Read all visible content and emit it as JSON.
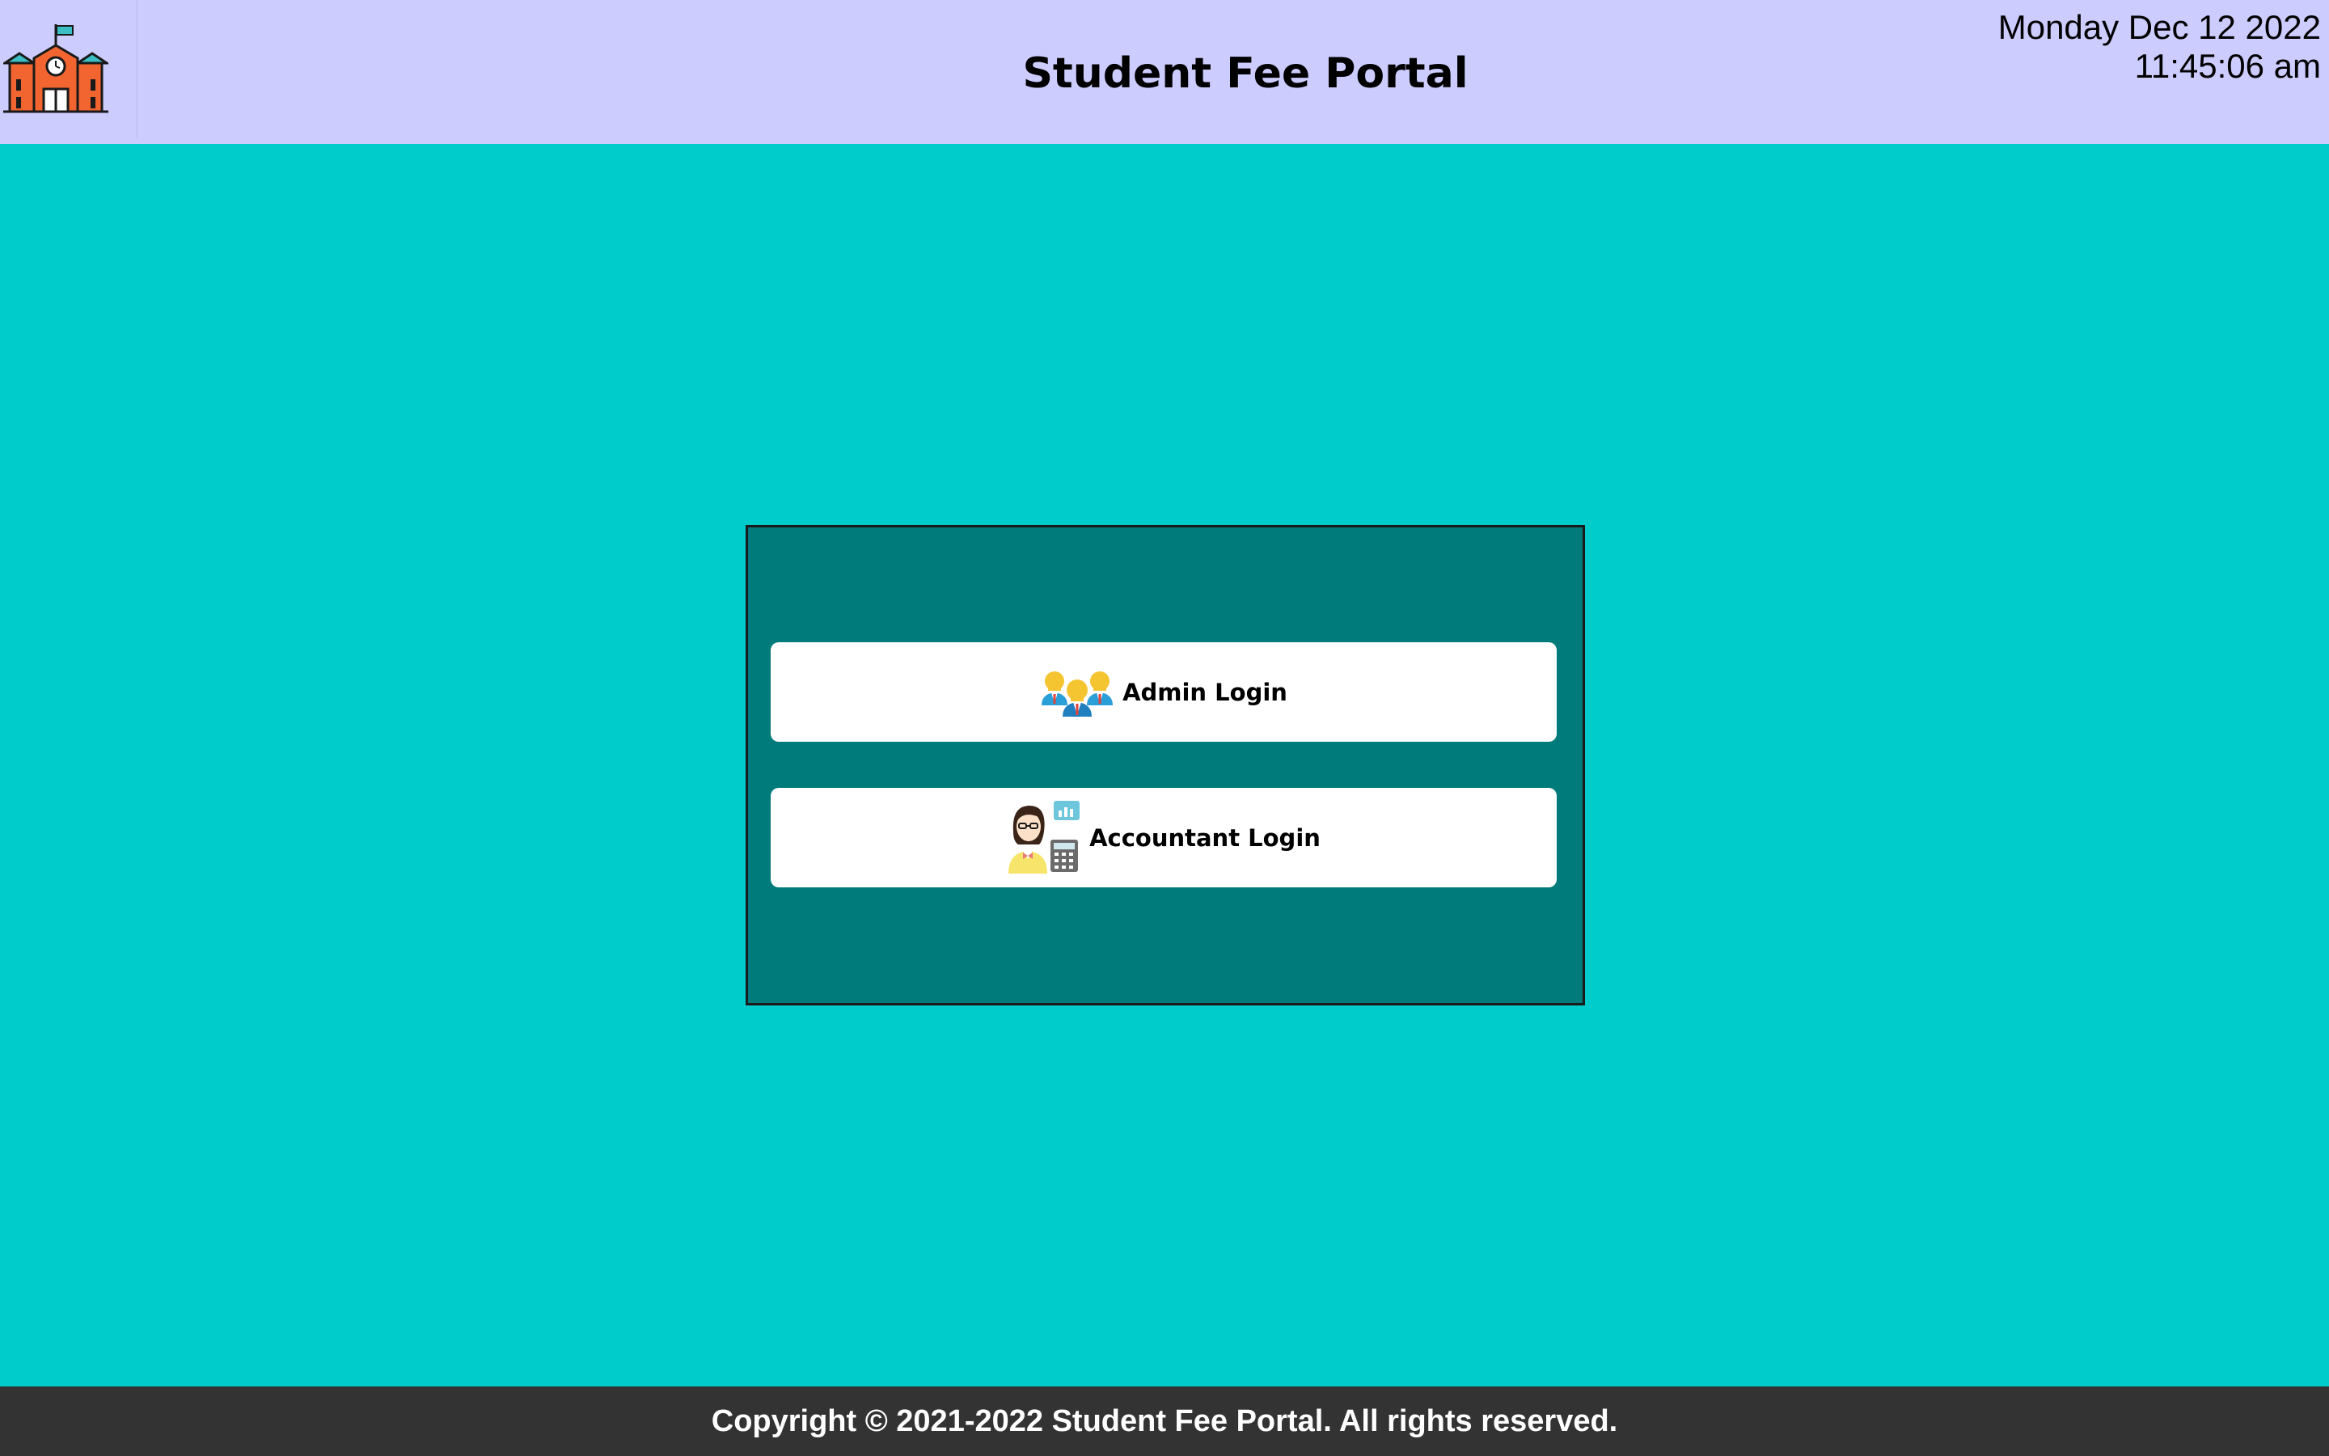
{
  "header": {
    "logo_icon": "school-building-icon",
    "title": "Student Fee Portal",
    "date": "Monday Dec 12 2022",
    "time": "11:45:06 am"
  },
  "login_panel": {
    "buttons": [
      {
        "label": "Admin Login",
        "icon": "admin-group-icon"
      },
      {
        "label": "Accountant Login",
        "icon": "accountant-icon"
      }
    ]
  },
  "footer": {
    "text": "Copyright © 2021-2022 Student Fee Portal. All rights reserved."
  },
  "colors": {
    "page_background": "#00cccc",
    "header_background": "#ccccff",
    "panel_background": "#007b7b",
    "button_background": "#ffffff",
    "footer_background": "#333333",
    "footer_text": "#ffffff"
  }
}
